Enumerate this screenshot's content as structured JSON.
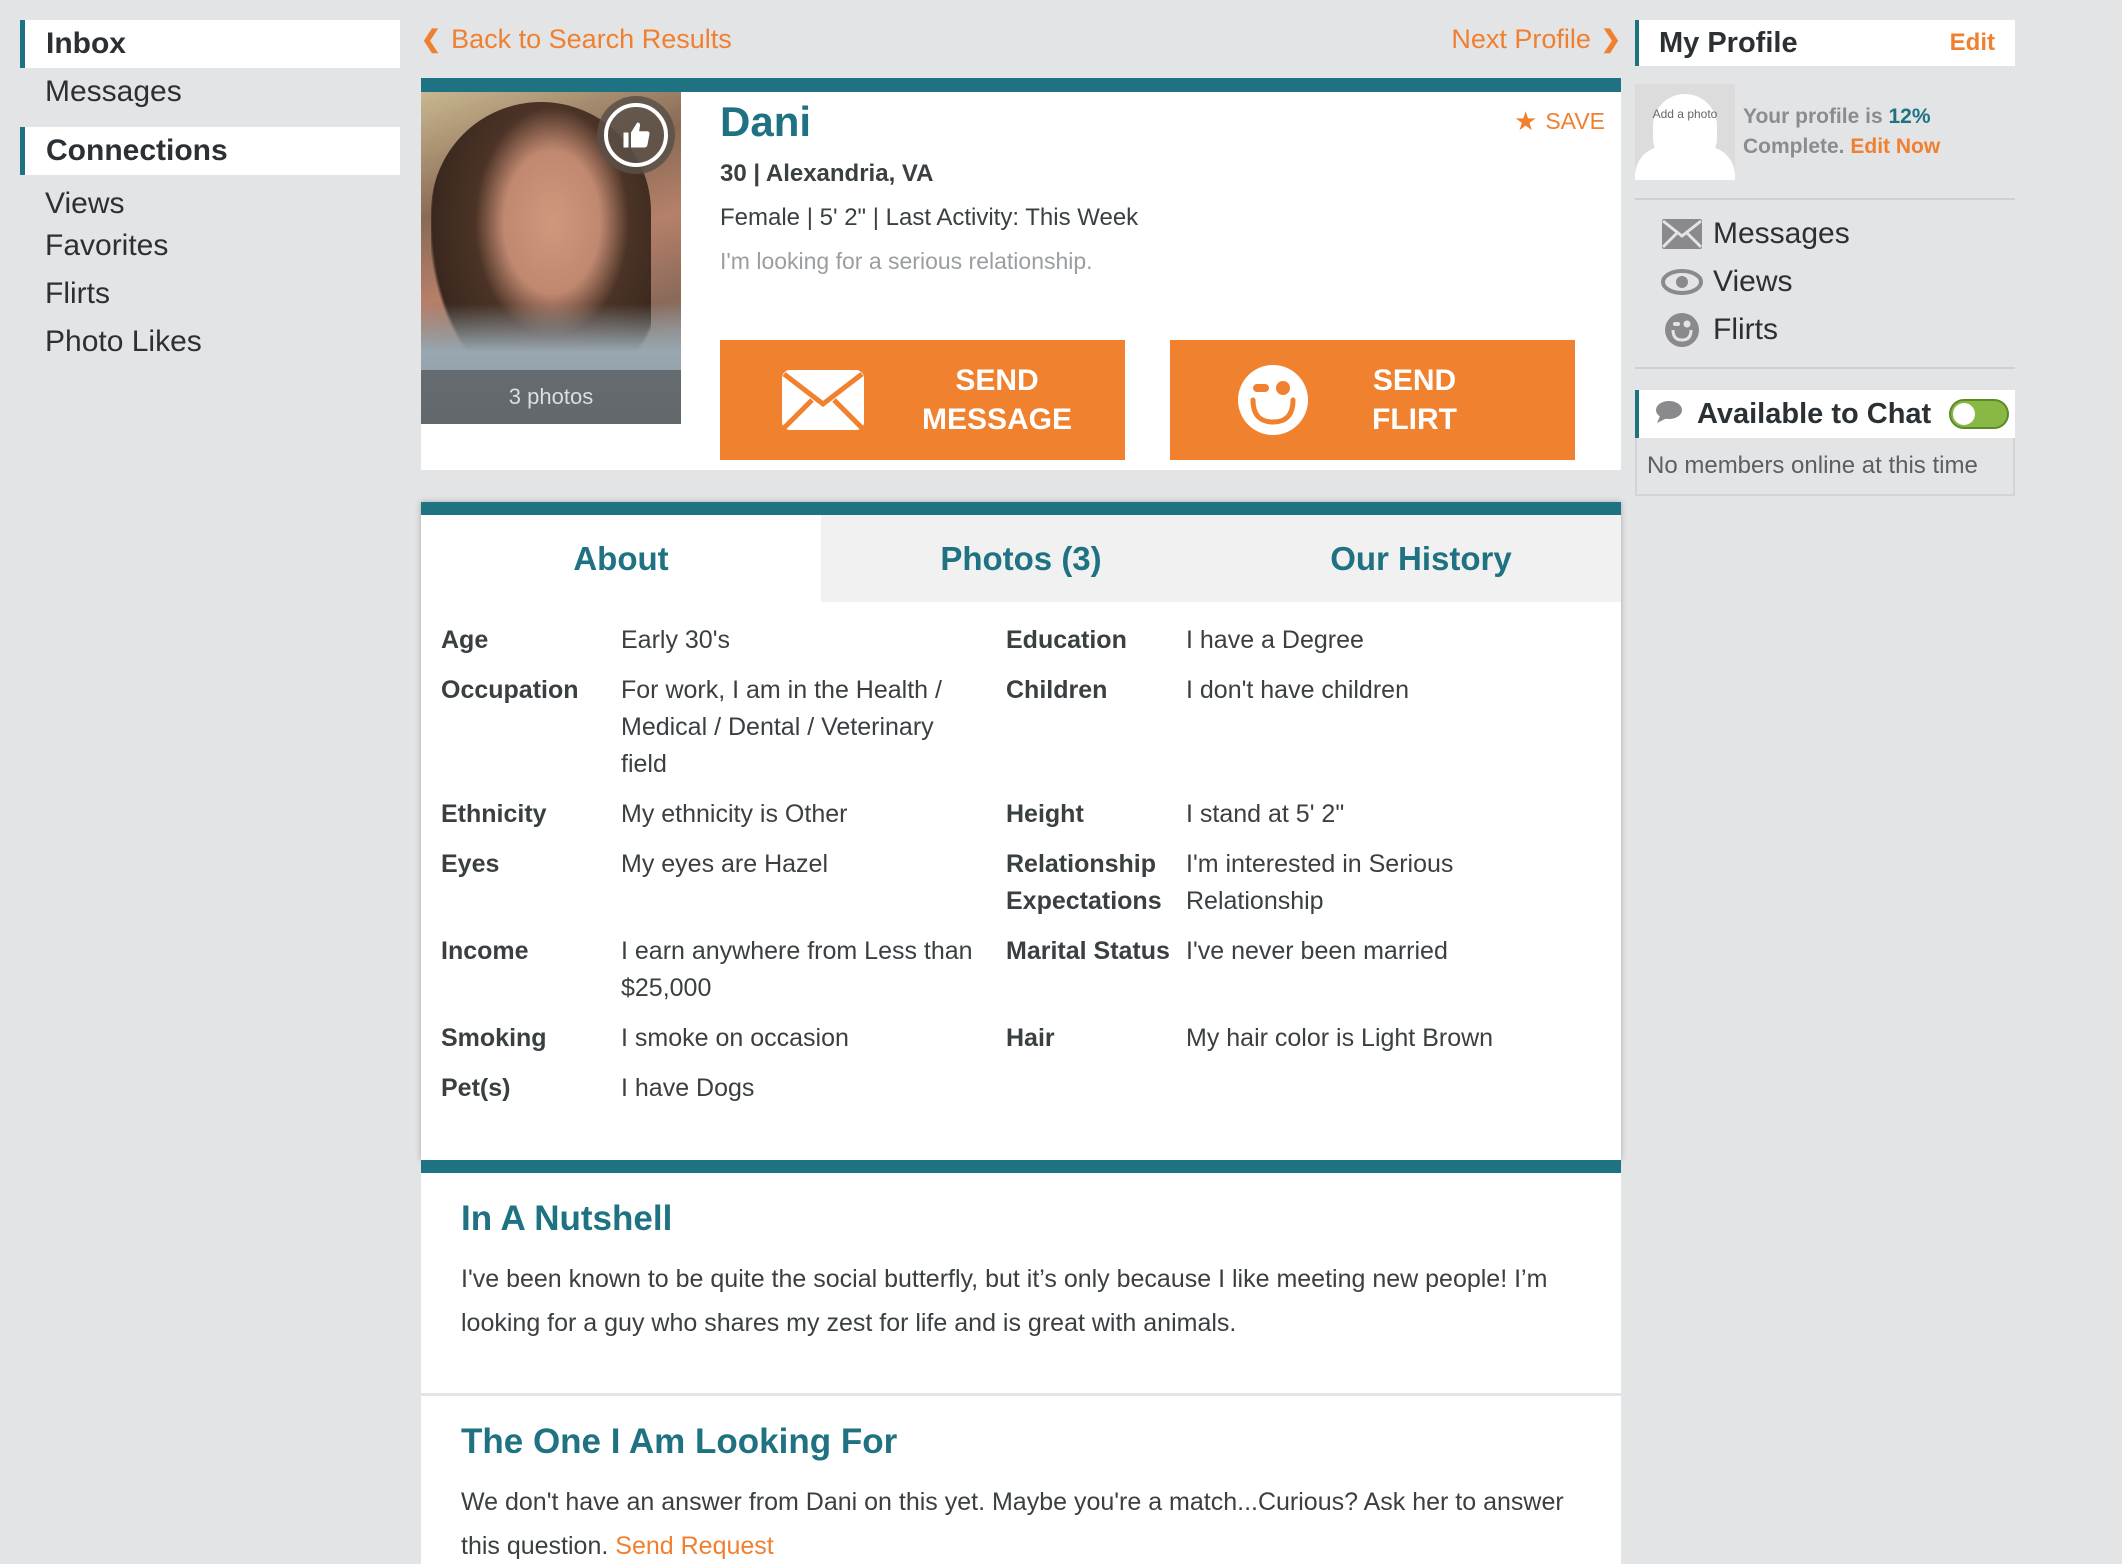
{
  "left_nav": {
    "inbox": "Inbox",
    "messages": "Messages",
    "connections": "Connections",
    "items": [
      "Views",
      "Favorites",
      "Flirts",
      "Photo Likes"
    ]
  },
  "top_links": {
    "back": "Back to Search Results",
    "next": "Next Profile"
  },
  "profile": {
    "name": "Dani",
    "age_location": "30 | Alexandria, VA",
    "details": "Female | 5' 2\" | Last Activity: This Week",
    "tagline": "I'm looking for a serious relationship.",
    "photo_count": "3 photos",
    "save_label": "SAVE",
    "send_message_line1": "SEND",
    "send_message_line2": "MESSAGE",
    "send_flirt_line1": "SEND",
    "send_flirt_line2": "FLIRT"
  },
  "tabs": [
    {
      "label": "About",
      "active": true
    },
    {
      "label": "Photos (3)",
      "active": false
    },
    {
      "label": "Our History",
      "active": false
    }
  ],
  "about_left": [
    {
      "key": "Age",
      "value": "Early 30's"
    },
    {
      "key": "Occupation",
      "value": "For work, I am in the Health / Medical / Dental / Veterinary field"
    },
    {
      "key": "Ethnicity",
      "value": "My ethnicity is Other"
    },
    {
      "key": "Eyes",
      "value": "My eyes are Hazel"
    },
    {
      "key": "Income",
      "value": "I earn anywhere from Less than $25,000"
    },
    {
      "key": "Smoking",
      "value": "I smoke on occasion"
    },
    {
      "key": "Pet(s)",
      "value": "I have Dogs"
    }
  ],
  "about_right": [
    {
      "key": "Education",
      "value": "I have a Degree"
    },
    {
      "key": "Children",
      "value": "I don't have children"
    },
    {
      "key": "Height",
      "value": "I stand at 5' 2\""
    },
    {
      "key": "Relationship Expectations",
      "value": "I'm interested in Serious Relationship"
    },
    {
      "key": "Marital Status",
      "value": "I've never been married"
    },
    {
      "key": "Hair",
      "value": "My hair color is Light Brown"
    }
  ],
  "sections": {
    "nutshell_title": "In A Nutshell",
    "nutshell_body": "I've been known to be quite the social butterfly, but it’s only because I like meeting new people! I’m looking for a guy who shares my zest for life and is great with animals.",
    "looking_title": "The One I Am Looking For",
    "looking_body": "We don't have an answer from Dani on this yet. Maybe you're a match...Curious? Ask her to answer this question.",
    "looking_link": "Send Request"
  },
  "my_profile": {
    "title": "My Profile",
    "edit": "Edit",
    "add_photo": "Add a photo",
    "completion_prefix": "Your profile is",
    "completion_pct": "12%",
    "completion_suffix": "Complete.",
    "edit_now": "Edit Now",
    "links": [
      "Messages",
      "Views",
      "Flirts"
    ]
  },
  "chat": {
    "title": "Available to Chat",
    "toggle_on": true,
    "empty": "No members online at this time"
  },
  "colors": {
    "accent_teal": "#1e7282",
    "accent_orange": "#f08030",
    "toggle_green": "#8ab845"
  }
}
